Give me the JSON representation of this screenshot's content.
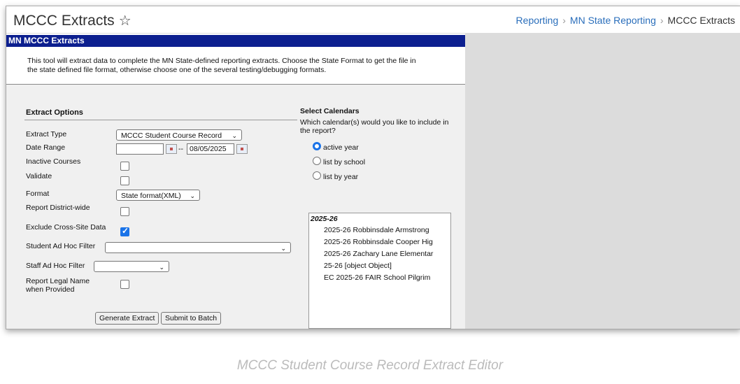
{
  "header": {
    "title": "MCCC Extracts",
    "breadcrumbs": [
      "Reporting",
      "MN State Reporting",
      "MCCC Extracts"
    ]
  },
  "panel": {
    "title": "MN MCCC Extracts",
    "description_line1": "This tool will extract data to complete the MN State-defined reporting extracts. Choose the State Format to get the file in",
    "description_line2": "the state defined file format, otherwise choose one of the several testing/debugging formats."
  },
  "extract_options": {
    "title": "Extract Options",
    "extract_type_label": "Extract Type",
    "extract_type_value": "MCCC Student Course Record",
    "date_range_label": "Date Range",
    "date_start": "",
    "date_separator": "--",
    "date_end": "08/05/2025",
    "inactive_courses_label": "Inactive Courses",
    "validate_label": "Validate",
    "format_label": "Format",
    "format_value": "State format(XML)",
    "report_district_label": "Report District-wide",
    "exclude_cross_site_label": "Exclude Cross-Site Data",
    "student_filter_label": "Student Ad Hoc Filter",
    "student_filter_value": "",
    "staff_filter_label": "Staff Ad Hoc Filter",
    "staff_filter_value": "",
    "legal_name_label_line1": "Report Legal Name",
    "legal_name_label_line2": "when Provided",
    "generate_button": "Generate Extract",
    "batch_button": "Submit to Batch"
  },
  "calendars": {
    "title": "Select Calendars",
    "question_line1": "Which calendar(s) would you like to include in",
    "question_line2": "the report?",
    "options": [
      "active year",
      "list by school",
      "list by year"
    ],
    "selected_option": "active year",
    "year_group": "2025-26",
    "items": [
      "2025-26 Robbinsdale Armstrong",
      "2025-26 Robbinsdale Cooper Hig",
      "2025-26 Zachary Lane Elementar",
      "25-26 [object Object]",
      "EC 2025-26 FAIR School Pilgrim"
    ]
  },
  "caption": "MCCC Student Course Record Extract Editor",
  "colors": {
    "header_bar": "#0c1f8f",
    "accent": "#1a73e8",
    "link": "#2a6ebb"
  }
}
